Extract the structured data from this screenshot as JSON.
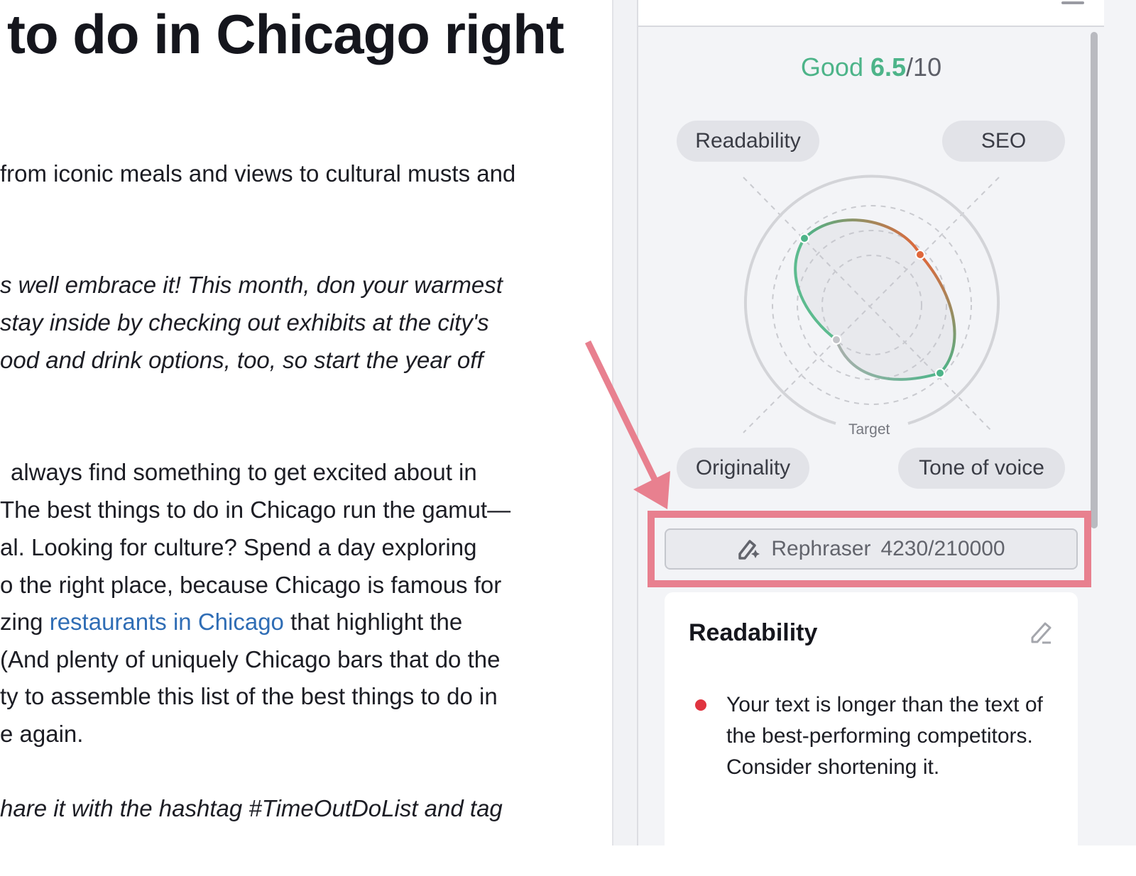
{
  "article": {
    "title_fragment": "to do in Chicago right",
    "intro_line": "from iconic meals and views to cultural musts and",
    "italic_lines": [
      "s well embrace it! This month, don your warmest",
      "stay inside by checking out exhibits at the city's",
      "ood and drink options, too, so start the year off"
    ],
    "body_lines": [
      "always find something to get excited about in",
      "The best things to do in Chicago run the gamut—",
      "al. Looking for culture? Spend a day exploring",
      "o the right place, because Chicago is famous for"
    ],
    "link_line": {
      "before": "zing ",
      "link": "restaurants in Chicago",
      "after": " that highlight the"
    },
    "body_lines_2": [
      "(And plenty of uniquely Chicago bars that do the",
      "ty to assemble this list of the best things to do in",
      "e again."
    ],
    "footer_italic": "hare it with the hashtag #TimeOutDoList and tag"
  },
  "panel": {
    "score": {
      "label": "Good",
      "value": "6.5",
      "max": "/10"
    },
    "radar": {
      "axes": [
        "Readability",
        "SEO",
        "Originality",
        "Tone of voice"
      ],
      "target_label": "Target",
      "colors": {
        "good": "#4db489",
        "warn": "#e0673a"
      }
    },
    "rephraser": {
      "label": "Rephraser",
      "count": "4230/210000"
    },
    "readability_card": {
      "title": "Readability",
      "issues": [
        "Your text is longer than the text of the best-performing competitors. Consider shortening it."
      ],
      "issue_color": "#e03440"
    }
  },
  "annotation_color": "#e8808f"
}
